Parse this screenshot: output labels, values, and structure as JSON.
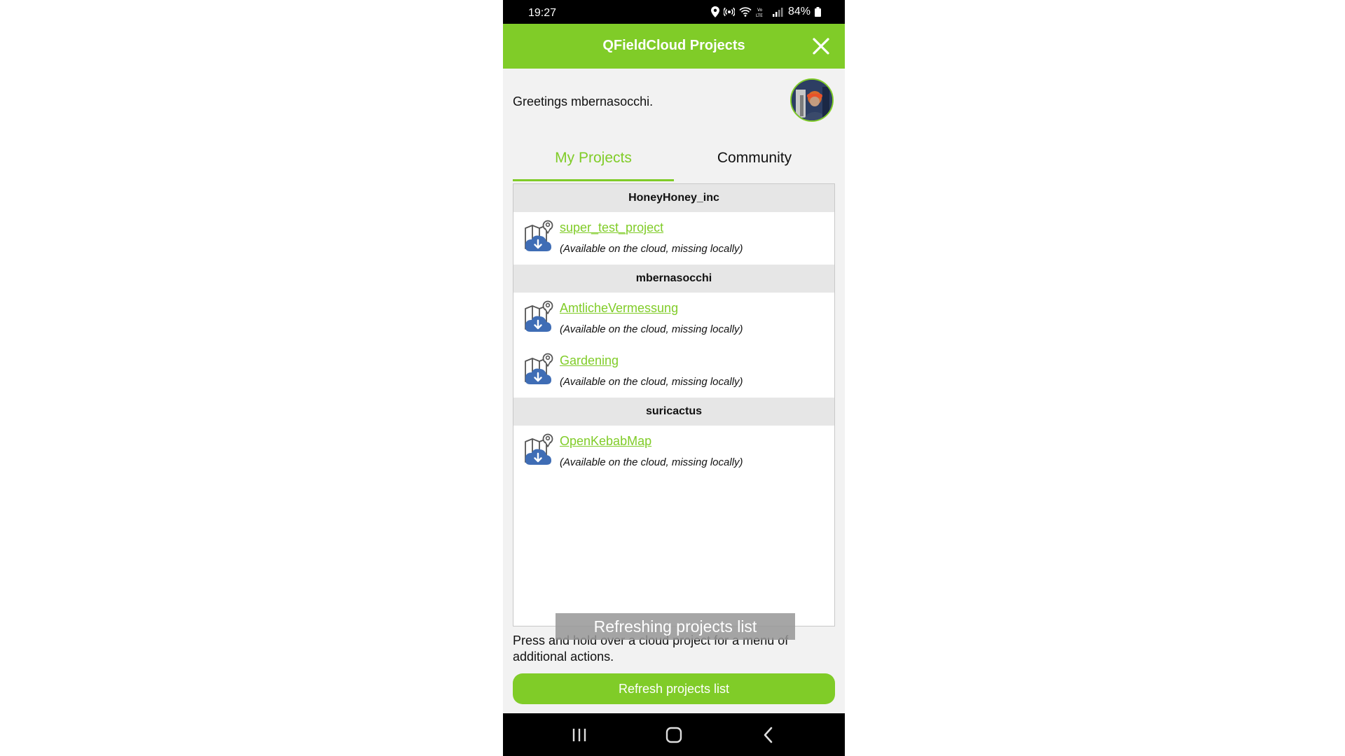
{
  "status_bar": {
    "time": "19:27",
    "battery": "84%",
    "icons": [
      "location-icon",
      "hotspot-icon",
      "wifi-icon",
      "volte-icon",
      "signal-icon",
      "battery-icon"
    ]
  },
  "header": {
    "title": "QFieldCloud Projects",
    "close_icon": "close-icon"
  },
  "greeting": "Greetings mbernasocchi.",
  "tabs": [
    {
      "label": "My Projects",
      "active": true
    },
    {
      "label": "Community",
      "active": false
    }
  ],
  "groups": [
    {
      "owner": "HoneyHoney_inc",
      "projects": [
        {
          "name": "super_test_project",
          "status": "(Available on the cloud, missing locally)"
        }
      ]
    },
    {
      "owner": "mbernasocchi",
      "projects": [
        {
          "name": "AmtlicheVermessung",
          "status": "(Available on the cloud, missing locally)"
        },
        {
          "name": "Gardening",
          "status": "(Available on the cloud, missing locally)"
        }
      ]
    },
    {
      "owner": "suricactus",
      "projects": [
        {
          "name": "OpenKebabMap",
          "status": "(Available on the cloud, missing locally)"
        }
      ]
    }
  ],
  "toast": "Refreshing projects list",
  "hint": "Press and hold over a cloud project for a menu of additional actions.",
  "refresh_button": "Refresh projects list",
  "nav": [
    "recents-icon",
    "home-icon",
    "back-icon"
  ],
  "colors": {
    "accent": "#80cc28",
    "link": "#80cc28",
    "icon_blue": "#3f6db5"
  }
}
